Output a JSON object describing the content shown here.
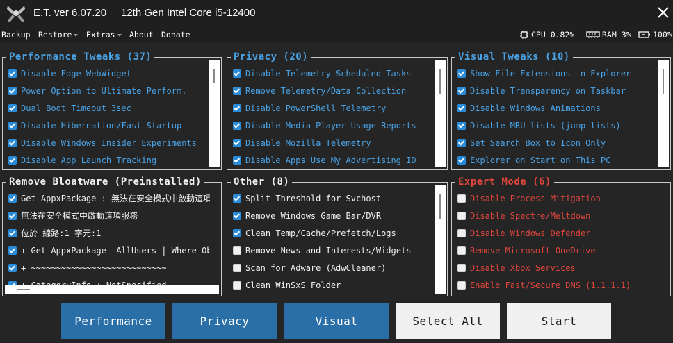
{
  "app": {
    "title": "E.T. ver 6.07.20",
    "cpu_name": "12th Gen Intel Core i5-12400"
  },
  "menu": [
    "Backup",
    "Restore",
    "Extras",
    "About",
    "Donate"
  ],
  "status": {
    "cpu": "CPU 0.82%",
    "ram": "RAM 3%",
    "battery": "100%"
  },
  "panels": {
    "performance": {
      "title": "Performance Tweaks (37)",
      "items": [
        {
          "label": "Disable Edge WebWidget",
          "checked": true
        },
        {
          "label": "Power Option to Ultimate Perform.",
          "checked": true
        },
        {
          "label": "Dual Boot Timeout 3sec",
          "checked": true
        },
        {
          "label": "Disable Hibernation/Fast Startup",
          "checked": true
        },
        {
          "label": "Disable Windows Insider Experiments",
          "checked": true
        },
        {
          "label": "Disable App Launch Tracking",
          "checked": true
        }
      ]
    },
    "privacy": {
      "title": "Privacy (20)",
      "items": [
        {
          "label": "Disable Telemetry Scheduled Tasks",
          "checked": true
        },
        {
          "label": "Remove Telemetry/Data Collection",
          "checked": true
        },
        {
          "label": "Disable PowerShell Telemetry",
          "checked": true
        },
        {
          "label": "Disable Media Player Usage Reports",
          "checked": true
        },
        {
          "label": "Disable Mozilla Telemetry",
          "checked": true
        },
        {
          "label": "Disable Apps Use My Advertising ID",
          "checked": true
        }
      ]
    },
    "visual": {
      "title": "Visual Tweaks (10)",
      "items": [
        {
          "label": "Show File Extensions in Explorer",
          "checked": true
        },
        {
          "label": "Disable Transparency on Taskbar",
          "checked": true
        },
        {
          "label": "Disable Windows Animations",
          "checked": true
        },
        {
          "label": "Disable MRU lists (jump lists)",
          "checked": true
        },
        {
          "label": "Set Search Box to Icon Only",
          "checked": true
        },
        {
          "label": "Explorer on Start on This PC",
          "checked": true
        }
      ]
    },
    "bloatware": {
      "title": "Remove Bloatware (Preinstalled)",
      "items": [
        {
          "label": "Get-AppxPackage : 無法在安全模式中啟動這項",
          "checked": true
        },
        {
          "label": "無法在安全模式中啟動這項服務",
          "checked": true
        },
        {
          "label": "位於 線路:1 字元:1",
          "checked": true
        },
        {
          "label": "+ Get-AppxPackage -AllUsers | Where-Ob",
          "checked": true
        },
        {
          "label": "+ ~~~~~~~~~~~~~~~~~~~~~~~~~~~",
          "checked": true
        },
        {
          "label": "    + CategoryInfo          : NotSpecified",
          "checked": true
        }
      ]
    },
    "other": {
      "title": "Other (8)",
      "items": [
        {
          "label": "Split Threshold for Svchost",
          "checked": true
        },
        {
          "label": "Remove Windows Game Bar/DVR",
          "checked": true
        },
        {
          "label": "Clean Temp/Cache/Prefetch/Logs",
          "checked": true
        },
        {
          "label": "Remove News and Interests/Widgets",
          "checked": false
        },
        {
          "label": "Scan for Adware (AdwCleaner)",
          "checked": false
        },
        {
          "label": "Clean WinSxS Folder",
          "checked": false
        }
      ]
    },
    "expert": {
      "title": "Expert Mode (6)",
      "items": [
        {
          "label": "Disable Process Mitigation",
          "checked": false
        },
        {
          "label": "Disable Spectre/Meltdown",
          "checked": false
        },
        {
          "label": "Disable Windows Defender",
          "checked": false
        },
        {
          "label": "Remove Microsoft OneDrive",
          "checked": false
        },
        {
          "label": "Disable Xbox Services",
          "checked": false
        },
        {
          "label": "Enable Fast/Secure DNS (1.1.1.1)",
          "checked": false
        }
      ]
    }
  },
  "buttons": {
    "performance": "Performance",
    "privacy": "Privacy",
    "visual": "Visual",
    "select_all": "Select All",
    "start": "Start"
  },
  "colors": {
    "accent_blue": "#4aa3e6",
    "expert_red": "#e0463c",
    "button_blue": "#2b6fa8",
    "checkbox_blue": "#2a8bd8",
    "background": "#252526"
  }
}
